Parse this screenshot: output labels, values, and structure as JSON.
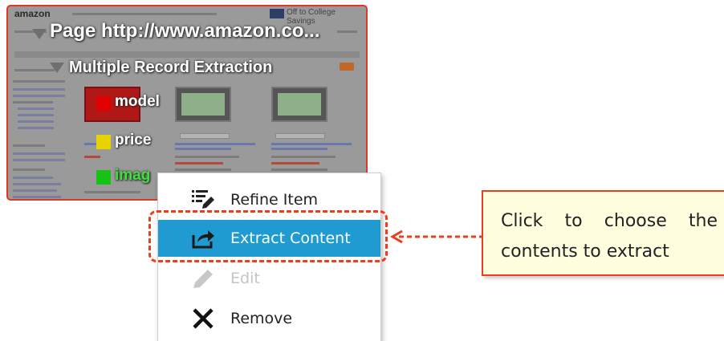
{
  "thumbnail": {
    "site_logo": "amazon",
    "deal_banner": "Off to College Savings",
    "page_title": "Page  http://www.amazon.co...",
    "extraction_title": "Multiple Record Extraction",
    "fields": [
      {
        "label": "model",
        "color": "#e00000"
      },
      {
        "label": "price",
        "color": "#e6d400"
      },
      {
        "label": "imag",
        "color": "#17c217"
      }
    ]
  },
  "context_menu": {
    "items": [
      {
        "label": "Refine Item",
        "icon": "refine-list-pencil-icon",
        "state": "normal"
      },
      {
        "label": "Extract Content",
        "icon": "export-share-icon",
        "state": "highlighted"
      },
      {
        "label": "Edit",
        "icon": "pencil-icon",
        "state": "disabled"
      },
      {
        "label": "Remove",
        "icon": "x-close-icon",
        "state": "normal"
      }
    ]
  },
  "callout": {
    "line1": "Click to choose the",
    "line2": "contents to extract"
  },
  "colors": {
    "accent_red": "#e8401c",
    "menu_highlight": "#1f9bd1",
    "callout_bg": "#ffffe0"
  }
}
